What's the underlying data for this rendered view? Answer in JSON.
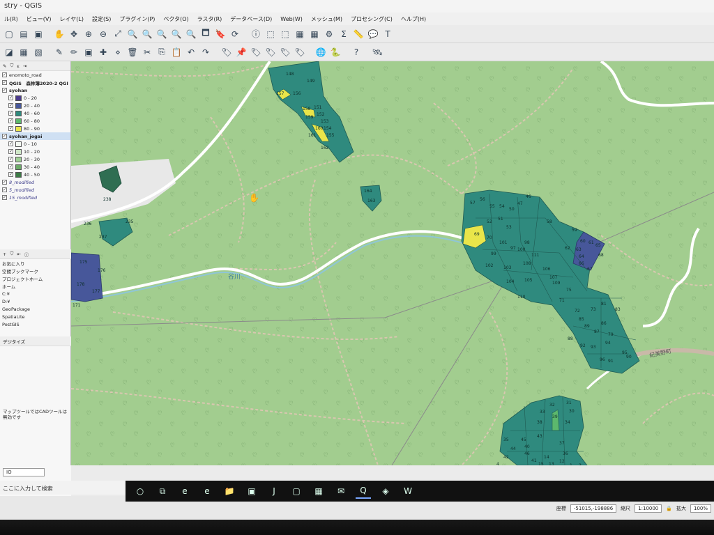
{
  "window": {
    "title": "stry - QGIS"
  },
  "menu": [
    "ル(R)",
    "ビュー(V)",
    "レイヤ(L)",
    "設定(S)",
    "プラグイン(P)",
    "ベクタ(O)",
    "ラスタ(R)",
    "データベース(D)",
    "Web(W)",
    "メッシュ(M)",
    "プロセシング(C)",
    "ヘルプ(H)"
  ],
  "layers_panel": {
    "items": [
      {
        "label": "enomoto_road",
        "kind": "layer"
      },
      {
        "label": "QGIS　森林簿2020-2 QGI",
        "kind": "group"
      },
      {
        "label": "syohan",
        "kind": "group"
      }
    ],
    "syohan_classes": [
      {
        "label": "0 - 20",
        "color": "#4b3a8c"
      },
      {
        "label": "20 - 40",
        "color": "#47579a"
      },
      {
        "label": "40 - 60",
        "color": "#2f8a7e"
      },
      {
        "label": "60 - 80",
        "color": "#5cb86d"
      },
      {
        "label": "80 - 90",
        "color": "#e9e54a"
      }
    ],
    "jogai_label": "syohan_jogai",
    "jogai_classes": [
      {
        "label": "0 - 10",
        "color": "#f2f7f0"
      },
      {
        "label": "10 - 20",
        "color": "#cfe7c8"
      },
      {
        "label": "20 - 30",
        "color": "#9fcf95"
      },
      {
        "label": "30 - 40",
        "color": "#6baa67"
      },
      {
        "label": "40 - 50",
        "color": "#3c7a45"
      }
    ],
    "modified": [
      "8_modified",
      "5_modified",
      "15_modified"
    ]
  },
  "browser_panel": {
    "items": [
      "お気に入り",
      "空間ブックマーク",
      "プロジェクトホーム",
      "ホーム",
      "C:¥",
      "D:¥",
      "GeoPackage",
      "SpatiaLite",
      "PostGIS"
    ]
  },
  "digitize_panel": {
    "title": "デジタイズ",
    "message": "マップツールではCADツールは無効です"
  },
  "search": {
    "placeholder": "ここに入力して検索"
  },
  "status": {
    "coord_label": "座標",
    "coord_value": "-51015,-198886",
    "scale_label": "縮尺",
    "scale_value": "1:10000",
    "zoom_label": "拡大",
    "zoom_value": "100%",
    "search_box_value": "IO"
  },
  "map": {
    "river_label": "谷川",
    "road_label": "紀美野町",
    "stand_labels": {
      "north_cluster": [
        "148",
        "149",
        "156",
        "157",
        "158",
        "151",
        "152",
        "153",
        "154",
        "155",
        "159",
        "160",
        "161",
        "162"
      ],
      "east_cluster": [
        "57",
        "56",
        "55",
        "54",
        "50",
        "47",
        "46",
        "52",
        "51",
        "53",
        "58",
        "59",
        "60",
        "61",
        "62",
        "63",
        "64",
        "65",
        "66",
        "67",
        "68",
        "69",
        "70",
        "101",
        "97",
        "98",
        "99",
        "102",
        "103",
        "100",
        "111",
        "105",
        "104",
        "108",
        "106",
        "107",
        "110",
        "109",
        "71",
        "75",
        "72",
        "73",
        "81",
        "83",
        "85",
        "86",
        "87",
        "79",
        "89",
        "88",
        "92",
        "93",
        "94",
        "95",
        "96",
        "90",
        "91"
      ],
      "south_cluster": [
        "32",
        "31",
        "30",
        "33",
        "38",
        "39",
        "34",
        "35",
        "45",
        "43",
        "37",
        "40",
        "44",
        "46",
        "36",
        "41",
        "14",
        "42",
        "15",
        "13",
        "12",
        "1",
        "2",
        "3",
        "4",
        "47",
        "48"
      ],
      "center": [
        "164",
        "163"
      ],
      "west": [
        "236",
        "235",
        "237",
        "175",
        "176",
        "178",
        "177",
        "171",
        "238"
      ]
    }
  }
}
